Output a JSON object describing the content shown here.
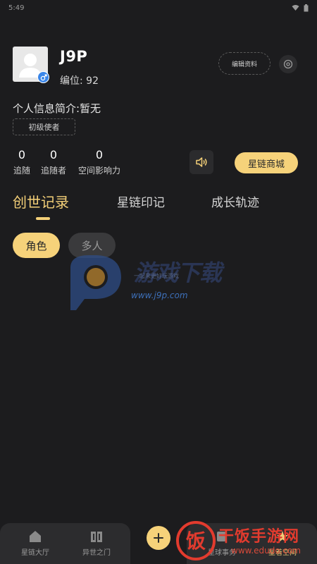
{
  "status_bar": {
    "time": "5:49"
  },
  "profile": {
    "username": "J9P",
    "user_id": "编位: 92",
    "edit_label": "编辑资料",
    "bio": "个人信息简介:暂无",
    "rank": "初级使者"
  },
  "stats": [
    {
      "value": "0",
      "label": "追随"
    },
    {
      "value": "0",
      "label": "追随者"
    },
    {
      "value": "0",
      "label": "空间影响力"
    }
  ],
  "shop_label": "星链商城",
  "tabs": [
    {
      "label": "创世记录",
      "active": true
    },
    {
      "label": "星链印记",
      "active": false
    },
    {
      "label": "成长轨迹",
      "active": false
    }
  ],
  "filters": [
    {
      "label": "角色",
      "active": true
    },
    {
      "label": "多人",
      "active": false
    }
  ],
  "watermark": {
    "brand": "游戏下载",
    "tagline": "一起来更好玩游戏",
    "url": "www.j9p.com"
  },
  "bottom_nav": [
    {
      "label": "星链大厅",
      "icon": "home-icon",
      "active": false
    },
    {
      "label": "异世之门",
      "icon": "portal-icon",
      "active": false
    },
    {
      "label": "星球事务",
      "icon": "planet-icon",
      "active": false
    },
    {
      "label": "星着空间",
      "icon": "space-icon",
      "active": true
    }
  ],
  "corner_watermark": {
    "name": "干饭手游网",
    "url": "www.edudo.com",
    "icon_text": "饭"
  },
  "colors": {
    "background": "#1c1c1e",
    "accent": "#f6d27a",
    "accent_text": "#f3cf78",
    "gender_badge": "#3a86e8"
  }
}
